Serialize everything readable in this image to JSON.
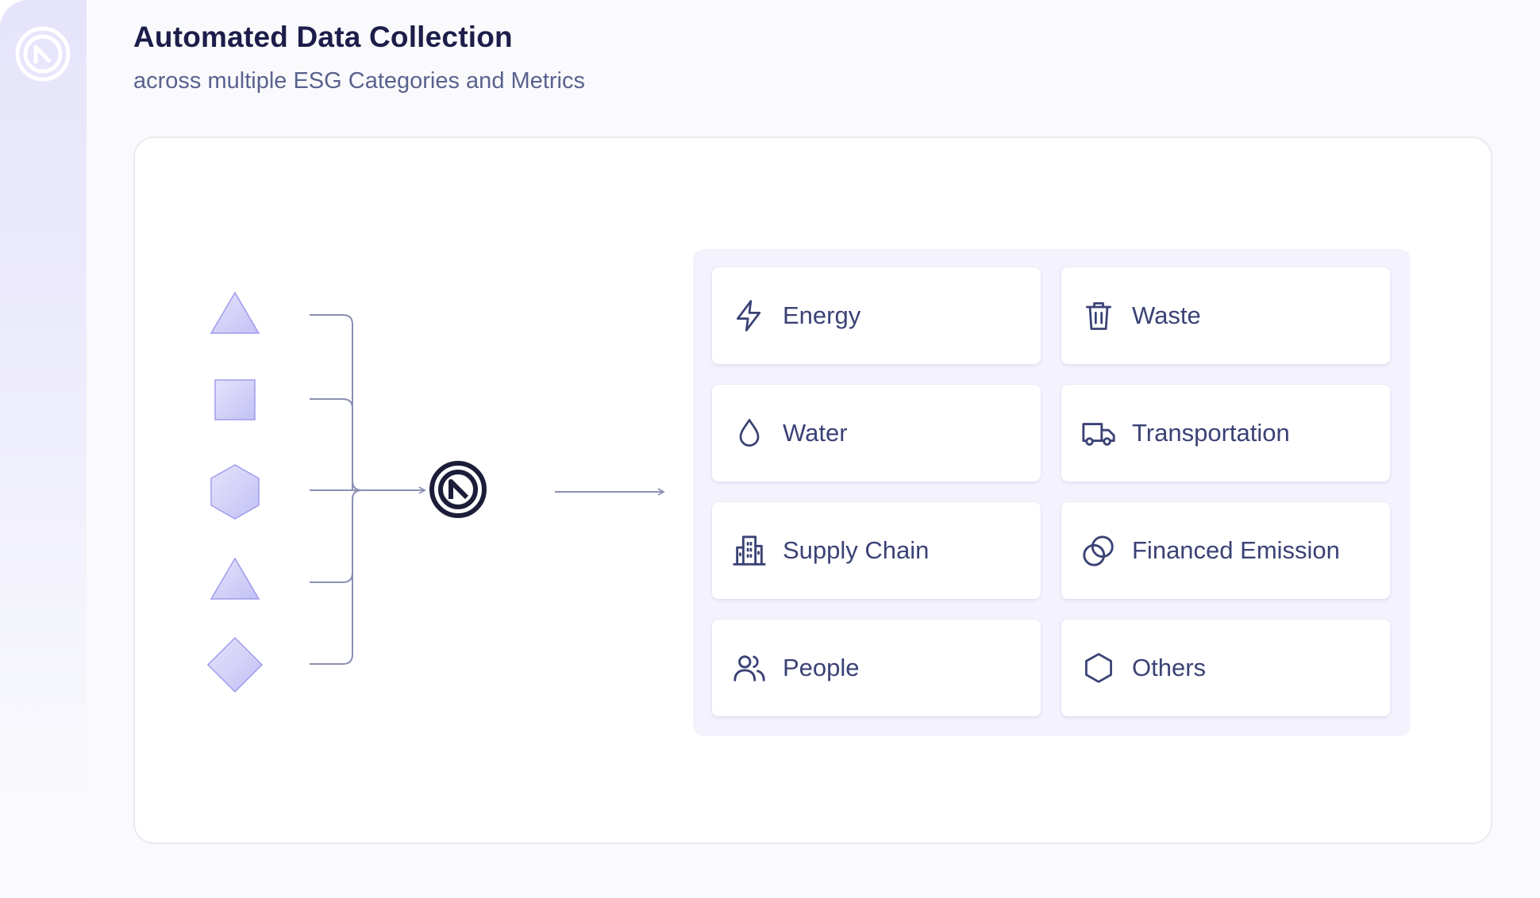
{
  "header": {
    "title": "Automated Data Collection",
    "subtitle": "across multiple ESG Categories and Metrics"
  },
  "sources": [
    {
      "shape": "triangle"
    },
    {
      "shape": "square"
    },
    {
      "shape": "hexagon"
    },
    {
      "shape": "triangle"
    },
    {
      "shape": "diamond"
    }
  ],
  "categories": [
    {
      "label": "Energy",
      "icon": "lightning-icon"
    },
    {
      "label": "Waste",
      "icon": "trash-icon"
    },
    {
      "label": "Water",
      "icon": "water-drop-icon"
    },
    {
      "label": "Transportation",
      "icon": "truck-icon"
    },
    {
      "label": "Supply Chain",
      "icon": "buildings-icon"
    },
    {
      "label": "Financed Emission",
      "icon": "coins-icon"
    },
    {
      "label": "People",
      "icon": "people-icon"
    },
    {
      "label": "Others",
      "icon": "hexagon-icon"
    }
  ],
  "colors": {
    "title": "#1c1d4a",
    "subtitle": "#5a628e",
    "label": "#3a4275",
    "icon": "#3a4275",
    "shape_fill": "#ccccf7",
    "shape_stroke": "#a09bee",
    "connector": "#8a8fb3",
    "grid_bg": "#f3f2fd"
  }
}
